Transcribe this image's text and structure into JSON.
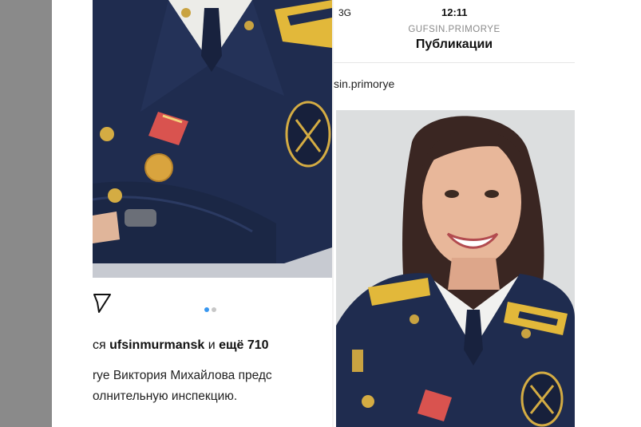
{
  "status_bar": {
    "network": "3G",
    "time": "12:11"
  },
  "header": {
    "profile_name": "GUFSIN.PRIMORYE",
    "title": "Публикации"
  },
  "post_right": {
    "account": "sin.primorye"
  },
  "post_left": {
    "likes_prefix": "ся ",
    "likes_user": "ufsinmurmansk",
    "likes_suffix": " и ",
    "likes_count": "ещё 710",
    "caption_line1": "rye Виктория Михайлова предс",
    "caption_line2": "олнительную инспекцию.",
    "carousel": {
      "total": 2,
      "active": 1
    }
  },
  "icons": {
    "share": "paper-plane-icon"
  },
  "colors": {
    "uniform": "#1f2c4f",
    "epaulette": "#e2b83a",
    "dot_active": "#3897f0",
    "dot_inactive": "#c7c7c7"
  }
}
